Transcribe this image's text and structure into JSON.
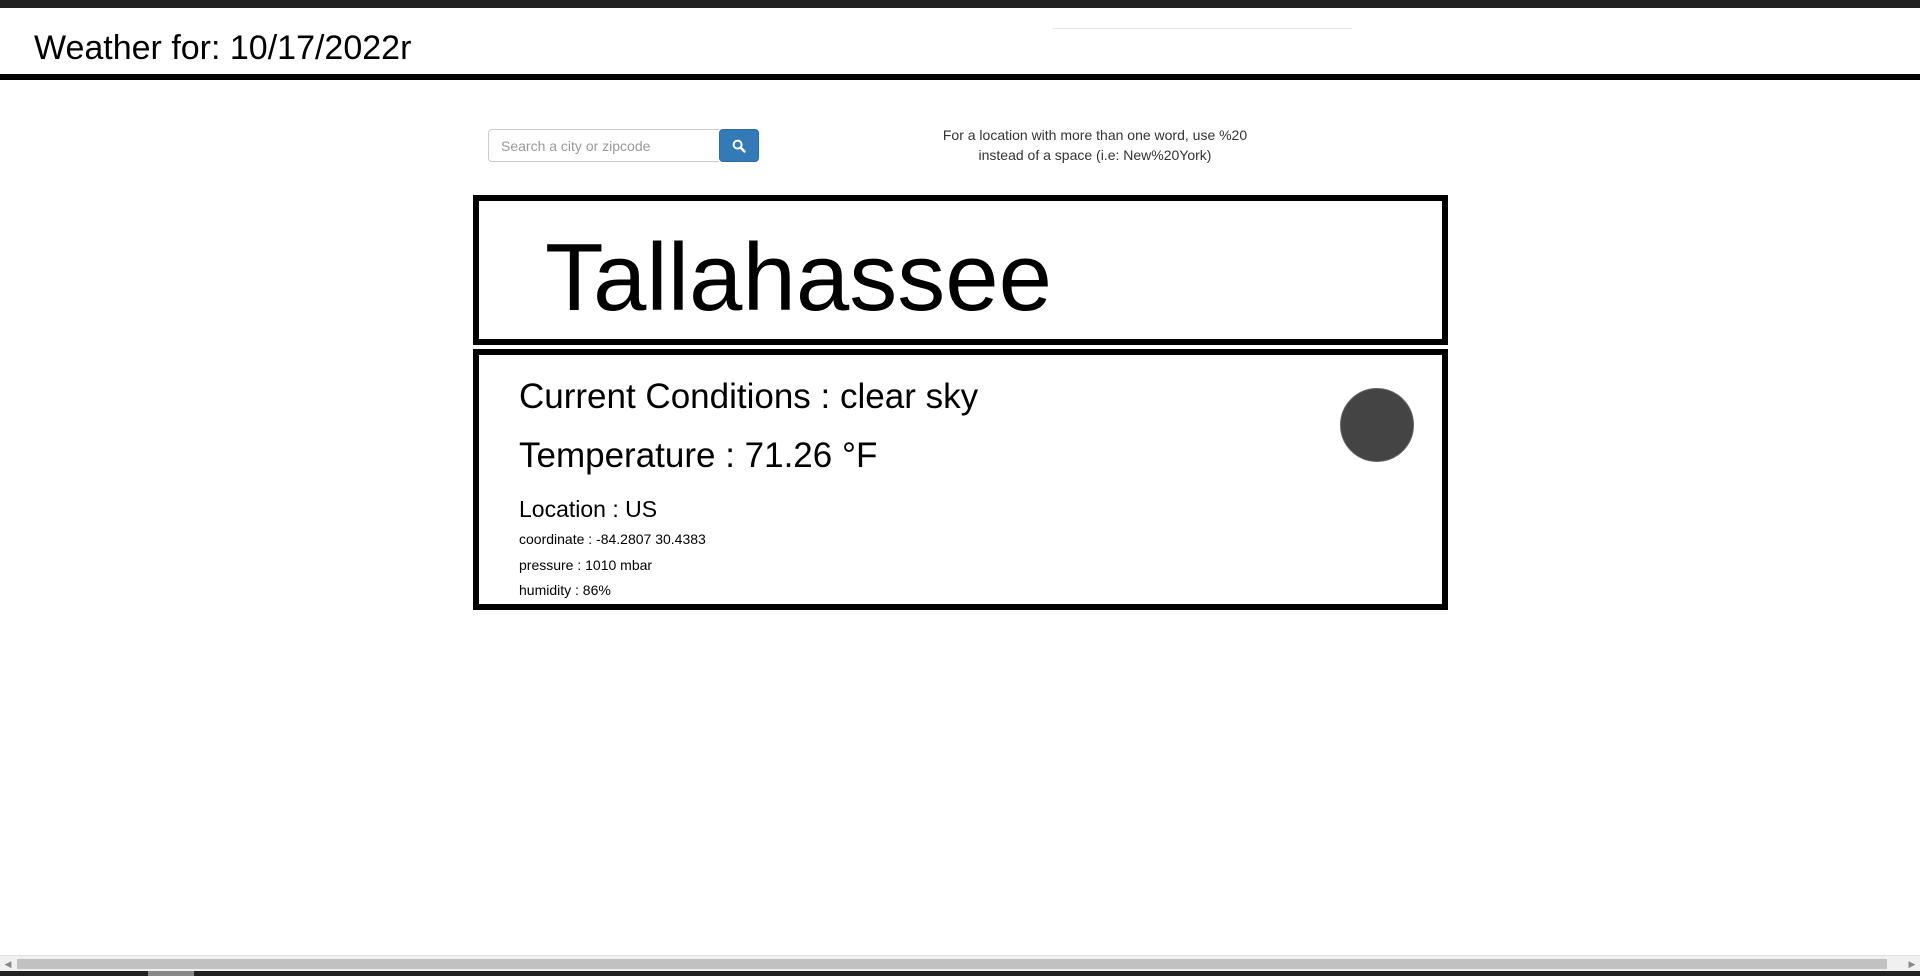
{
  "header": {
    "title": "Weather for: 10/17/2022r"
  },
  "search": {
    "placeholder": "Search a city or zipcode",
    "value": "",
    "button_icon": "search-icon"
  },
  "hint": {
    "line1": "For a location with more than one word, use %20",
    "line2": "instead of a space (i.e: New%20York)"
  },
  "weather": {
    "city": "Tallahassee",
    "conditions": "Current Conditions : clear sky",
    "temperature": "Temperature : 71.26 °F",
    "location": "Location : US",
    "coordinate": "coordinate : -84.2807 30.4383",
    "pressure": "pressure : 1010 mbar",
    "humidity": "humidity : 86%",
    "icon": "weather-condition-icon"
  },
  "scrollbar": {
    "left_arrow": "◀",
    "right_arrow": "▶"
  },
  "colors": {
    "search_button": "#337ab7",
    "icon_fill": "#444444",
    "border": "#000000"
  }
}
